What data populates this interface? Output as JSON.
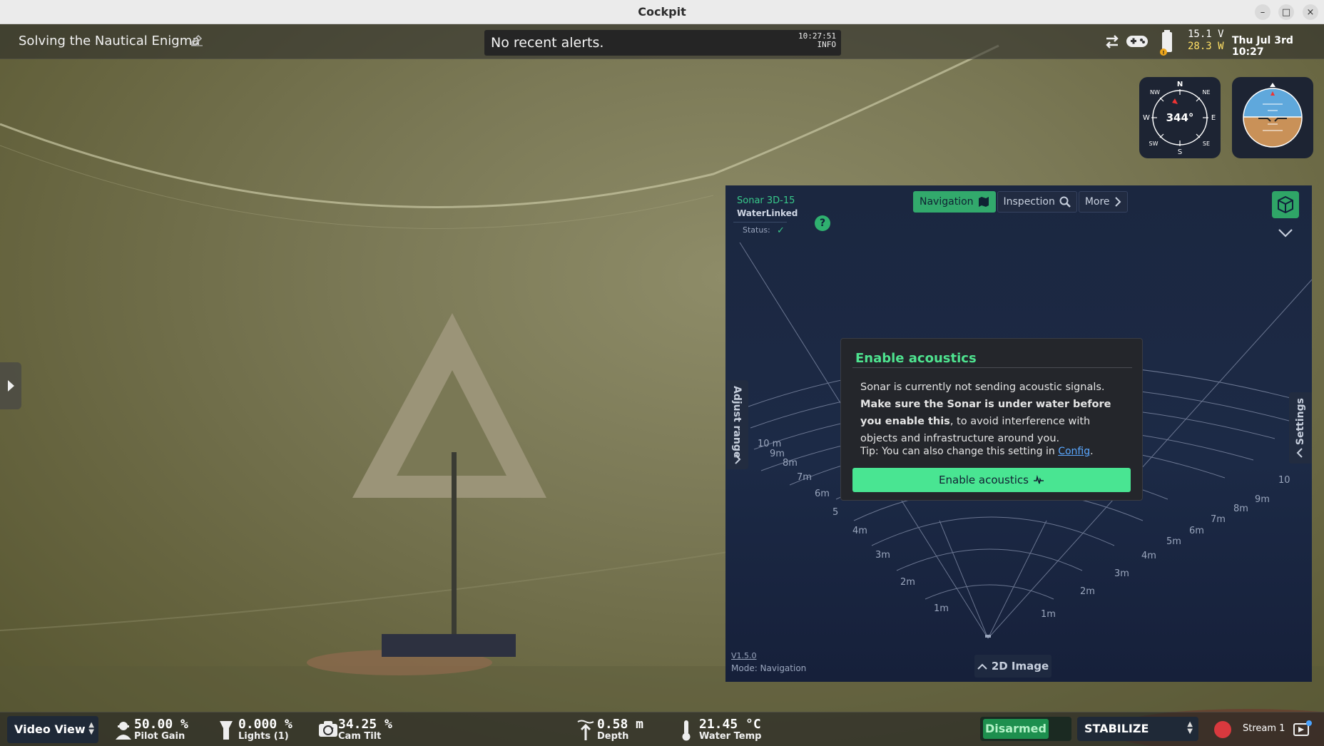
{
  "window": {
    "title": "Cockpit"
  },
  "topbar": {
    "mission_name": "Solving the Nautical Enigma",
    "alert_text": "No recent alerts.",
    "alert_time": "10:27:51",
    "alert_level": "INFO",
    "voltage": "15.1 V",
    "power": "28.3 W",
    "datetime": "Thu Jul 3rd 10:27"
  },
  "compass": {
    "heading": "344°",
    "labels": [
      "N",
      "NE",
      "E",
      "SE",
      "S",
      "SW",
      "W",
      "NW"
    ]
  },
  "sonar": {
    "model": "Sonar 3D-15",
    "brand": "WaterLinked",
    "status_label": "Status:",
    "tabs": [
      {
        "label": "Navigation",
        "active": true
      },
      {
        "label": "Inspection",
        "active": false
      },
      {
        "label": "More",
        "active": false
      }
    ],
    "adjust_range_label": "Adjust range",
    "settings_label": "Settings",
    "version": "V1.5.0",
    "mode": "Mode: Navigation",
    "image_2d_label": "2D Image",
    "range_labels_left": [
      "1m",
      "2m",
      "3m",
      "4m",
      "5",
      "6m",
      "7m",
      "8m",
      "9m",
      "10 m"
    ],
    "range_labels_right": [
      "1m",
      "2m",
      "3m",
      "4m",
      "5m",
      "6m",
      "7m",
      "8m",
      "9m",
      "10"
    ],
    "dialog": {
      "title": "Enable acoustics",
      "body_plain_1": "Sonar is currently not sending acoustic signals. ",
      "body_bold": "Make sure the Sonar is under water before you enable this",
      "body_plain_2": ", to avoid interference with objects and infrastructure around you.",
      "tip_prefix": "Tip: You can also change this setting in ",
      "tip_link": "Config",
      "tip_suffix": ".",
      "button_label": "Enable acoustics"
    }
  },
  "bottombar": {
    "view_name": "Video View",
    "pilot_gain": {
      "value": "50.00 %",
      "label": "Pilot Gain"
    },
    "lights": {
      "value": "0.000 %",
      "label": "Lights (1)"
    },
    "cam_tilt": {
      "value": "34.25 %",
      "label": "Cam Tilt"
    },
    "depth": {
      "value": "0.58 m",
      "label": "Depth"
    },
    "water_temp": {
      "value": "21.45 °C",
      "label": "Water Temp"
    },
    "arm_state": "Disarmed",
    "flight_mode": "STABILIZE",
    "stream": "Stream 1"
  },
  "colors": {
    "accent_green": "#49e592",
    "warning_yellow": "#ffe066",
    "sonar_bg": "#1b2740",
    "record_red": "#d9393e"
  }
}
